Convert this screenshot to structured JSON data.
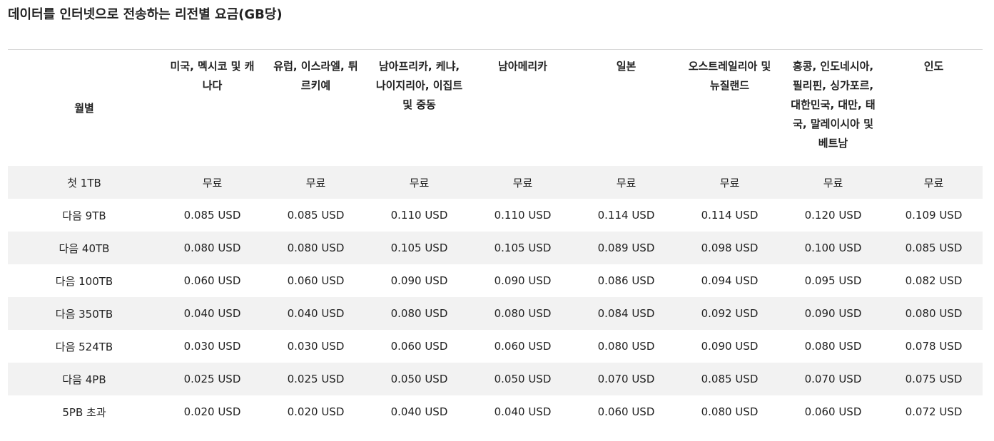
{
  "title": "데이터를 인터넷으로 전송하는 리전별 요금(GB당)",
  "table": {
    "headers": [
      "월별",
      "미국, 멕시코 및 캐나다",
      "유럽, 이스라엘, 튀르키예",
      "남아프리카, 케냐, 나이지리아, 이집트 및 중동",
      "남아메리카",
      "일본",
      "오스트레일리아 및 뉴질랜드",
      "홍콩, 인도네시아, 필리핀, 싱가포르, 대한민국, 대만, 태국, 말레이시아 및 베트남",
      "인도"
    ],
    "rows": [
      [
        "첫 1TB",
        "무료",
        "무료",
        "무료",
        "무료",
        "무료",
        "무료",
        "무료",
        "무료"
      ],
      [
        "다음 9TB",
        "0.085 USD",
        "0.085 USD",
        "0.110 USD",
        "0.110 USD",
        "0.114 USD",
        "0.114 USD",
        "0.120 USD",
        "0.109 USD"
      ],
      [
        "다음 40TB",
        "0.080 USD",
        "0.080 USD",
        "0.105 USD",
        "0.105 USD",
        "0.089 USD",
        "0.098 USD",
        "0.100 USD",
        "0.085 USD"
      ],
      [
        "다음 100TB",
        "0.060 USD",
        "0.060 USD",
        "0.090 USD",
        "0.090 USD",
        "0.086 USD",
        "0.094 USD",
        "0.095 USD",
        "0.082 USD"
      ],
      [
        "다음 350TB",
        "0.040 USD",
        "0.040 USD",
        "0.080 USD",
        "0.080 USD",
        "0.084 USD",
        "0.092 USD",
        "0.090 USD",
        "0.080 USD"
      ],
      [
        "다음 524TB",
        "0.030 USD",
        "0.030 USD",
        "0.060 USD",
        "0.060 USD",
        "0.080 USD",
        "0.090 USD",
        "0.080 USD",
        "0.078 USD"
      ],
      [
        "다음 4PB",
        "0.025 USD",
        "0.025 USD",
        "0.050 USD",
        "0.050 USD",
        "0.070 USD",
        "0.085 USD",
        "0.070 USD",
        "0.075 USD"
      ],
      [
        "5PB 초과",
        "0.020 USD",
        "0.020 USD",
        "0.040 USD",
        "0.040 USD",
        "0.060 USD",
        "0.080 USD",
        "0.060 USD",
        "0.072 USD"
      ]
    ]
  },
  "colors": {
    "shaded_row": "#f2f2f2",
    "rule": "#d9d9d9",
    "text": "#222222"
  }
}
